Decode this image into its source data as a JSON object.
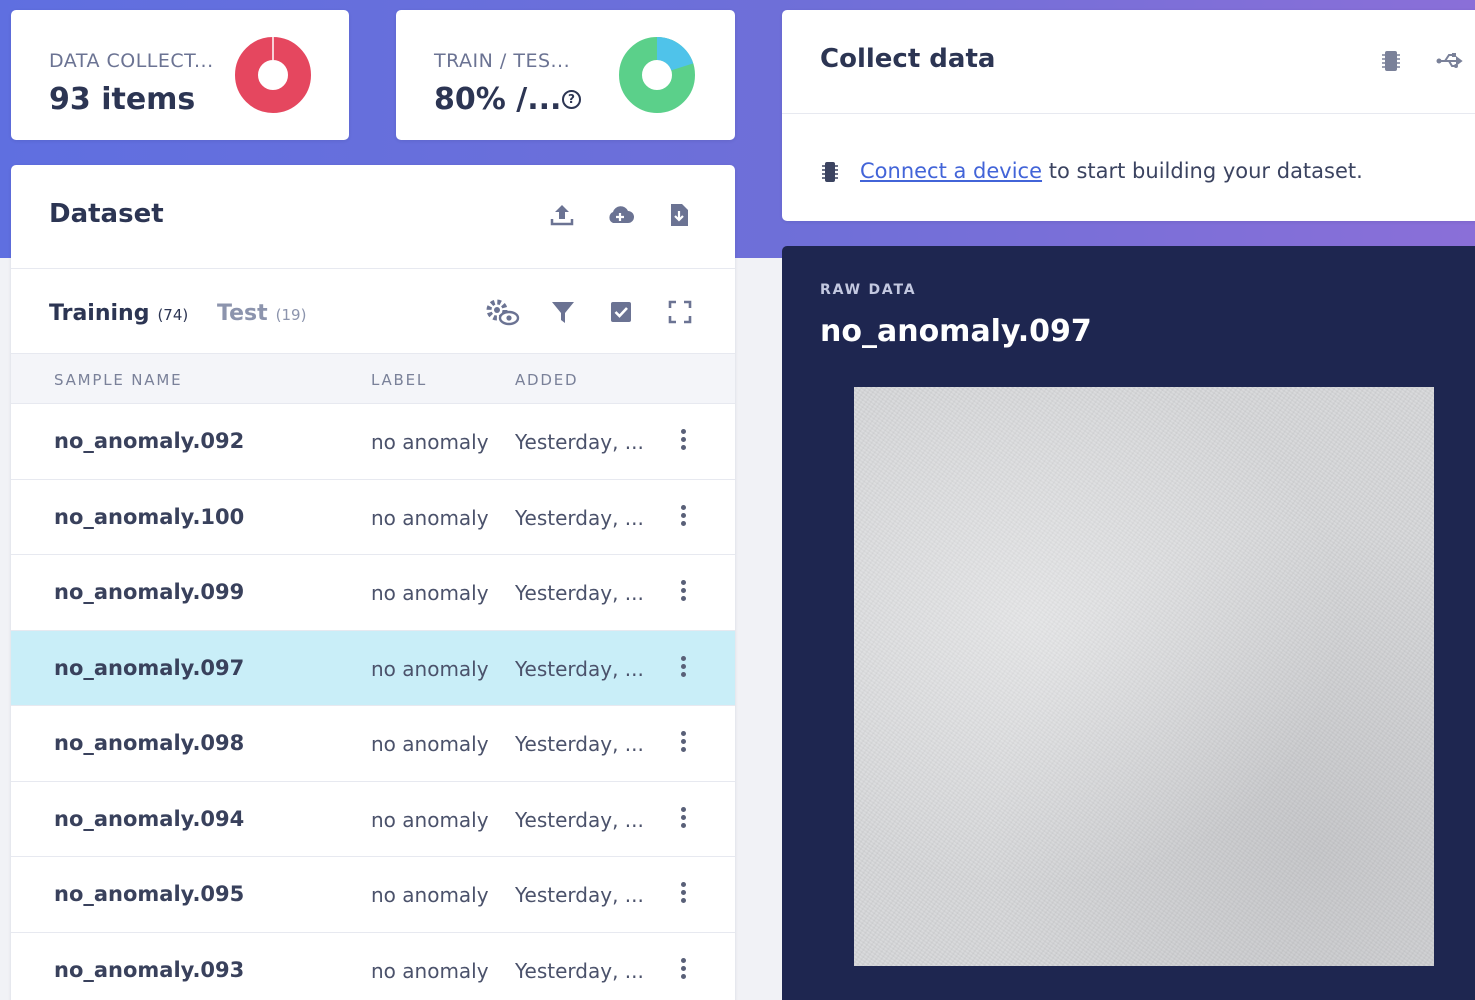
{
  "summary": {
    "data_collected": {
      "label": "DATA COLLECT...",
      "value": "93 items",
      "color": "#e5475f"
    },
    "train_test": {
      "label": "TRAIN / TES...",
      "value": "80% /...",
      "train_color": "#5bd08a",
      "test_color": "#4fc3ea",
      "train_fraction": 0.8
    }
  },
  "dataset": {
    "title": "Dataset",
    "header_icons": [
      "upload-icon",
      "cloud-add-icon",
      "download-icon"
    ],
    "tabs": [
      {
        "label": "Training",
        "count": "(74)",
        "active": true
      },
      {
        "label": "Test",
        "count": "(19)",
        "active": false
      }
    ],
    "toolbar_icons": [
      "settings-eye-icon",
      "filter-icon",
      "checkbox-icon",
      "fullscreen-icon"
    ],
    "columns": [
      "SAMPLE NAME",
      "LABEL",
      "ADDED"
    ],
    "rows": [
      {
        "name": "no_anomaly.092",
        "label": "no anomaly",
        "added": "Yesterday, ...",
        "selected": false
      },
      {
        "name": "no_anomaly.100",
        "label": "no anomaly",
        "added": "Yesterday, ...",
        "selected": false
      },
      {
        "name": "no_anomaly.099",
        "label": "no anomaly",
        "added": "Yesterday, ...",
        "selected": false
      },
      {
        "name": "no_anomaly.097",
        "label": "no anomaly",
        "added": "Yesterday, ...",
        "selected": true
      },
      {
        "name": "no_anomaly.098",
        "label": "no anomaly",
        "added": "Yesterday, ...",
        "selected": false
      },
      {
        "name": "no_anomaly.094",
        "label": "no anomaly",
        "added": "Yesterday, ...",
        "selected": false
      },
      {
        "name": "no_anomaly.095",
        "label": "no anomaly",
        "added": "Yesterday, ...",
        "selected": false
      },
      {
        "name": "no_anomaly.093",
        "label": "no anomaly",
        "added": "Yesterday, ...",
        "selected": false
      }
    ]
  },
  "collect": {
    "title": "Collect data",
    "header_icons": [
      "device-chip-icon",
      "usb-icon"
    ],
    "link_text": "Connect a device",
    "message_rest": " to start building your dataset."
  },
  "raw": {
    "label": "RAW DATA",
    "title": "no_anomaly.097"
  },
  "colors": {
    "hero_gradient_start": "#5f6fe0",
    "hero_gradient_end": "#8a6fd8",
    "selected_row": "#c9eef8",
    "raw_panel": "#1e2650",
    "link": "#4264d8"
  }
}
